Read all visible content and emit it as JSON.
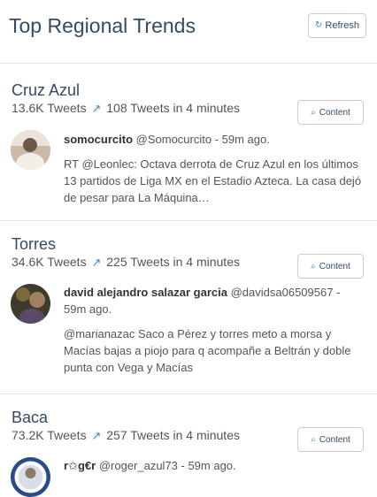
{
  "header": {
    "title": "Top Regional Trends",
    "refresh_label": "Refresh"
  },
  "trends": [
    {
      "name": "Cruz Azul",
      "tweet_count": "13.6K Tweets",
      "velocity": "108 Tweets in 4 minutes",
      "content_label": "Content",
      "tweet": {
        "user": "somocurcito",
        "handle": "@Somocurcito - 59m ago.",
        "text": "RT @Leonlec: Octava derrota de Cruz Azul en los últimos 13 partidos de Liga MX en el Estadio Azteca. La casa dejó de pesar para La Máquina…"
      }
    },
    {
      "name": "Torres",
      "tweet_count": "34.6K Tweets",
      "velocity": "225 Tweets in 4 minutes",
      "content_label": "Content",
      "tweet": {
        "user": "david alejandro salazar garcia",
        "handle": "@davidsa06509567 - 59m ago.",
        "text": "@marianazac Saco a Pérez y torres meto a morsa y Macías bajas a piojo para q acompañe a Beltrán y doble punta con Vega y Macías"
      }
    },
    {
      "name": "Baca",
      "tweet_count": "73.2K Tweets",
      "velocity": "257 Tweets in 4 minutes",
      "content_label": "Content",
      "tweet": {
        "user": "r✩g€r",
        "handle": "@roger_azul73 - 59m ago.",
        "text": ""
      }
    }
  ],
  "icons": {
    "refresh": "refresh-icon",
    "trend_arrow": "trending-up-icon",
    "content": "search-icon"
  },
  "colors": {
    "title": "#364a63",
    "accent": "#3a87c9",
    "divider": "#e3e3e3"
  }
}
